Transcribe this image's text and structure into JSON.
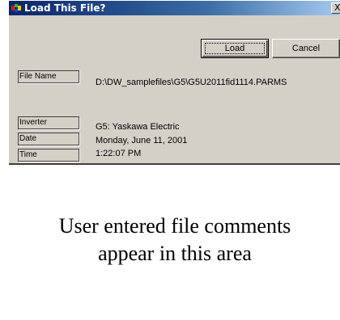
{
  "window": {
    "title": "Load This File?",
    "close_glyph": "X"
  },
  "buttons": {
    "load_label": "Load",
    "cancel_label": "Cancel"
  },
  "fields": {
    "file_name": {
      "label": "File Name",
      "value": "D:\\DW_samplefiles\\G5\\G5U2011fid1114.PARMS"
    },
    "inverter": {
      "label": "Inverter",
      "value": "G5: Yaskawa Electric"
    },
    "date": {
      "label": "Date",
      "value": "Monday, June 11, 2001"
    },
    "time": {
      "label": "Time",
      "value": "1:22:07 PM"
    }
  },
  "comments": {
    "text": "User entered file comments\nappear in this area"
  },
  "colors": {
    "titlebar_start": "#0a246a",
    "titlebar_end": "#a6caf0",
    "dialog_face": "#d4d0c8"
  },
  "icons": {
    "app": "app-icon"
  }
}
